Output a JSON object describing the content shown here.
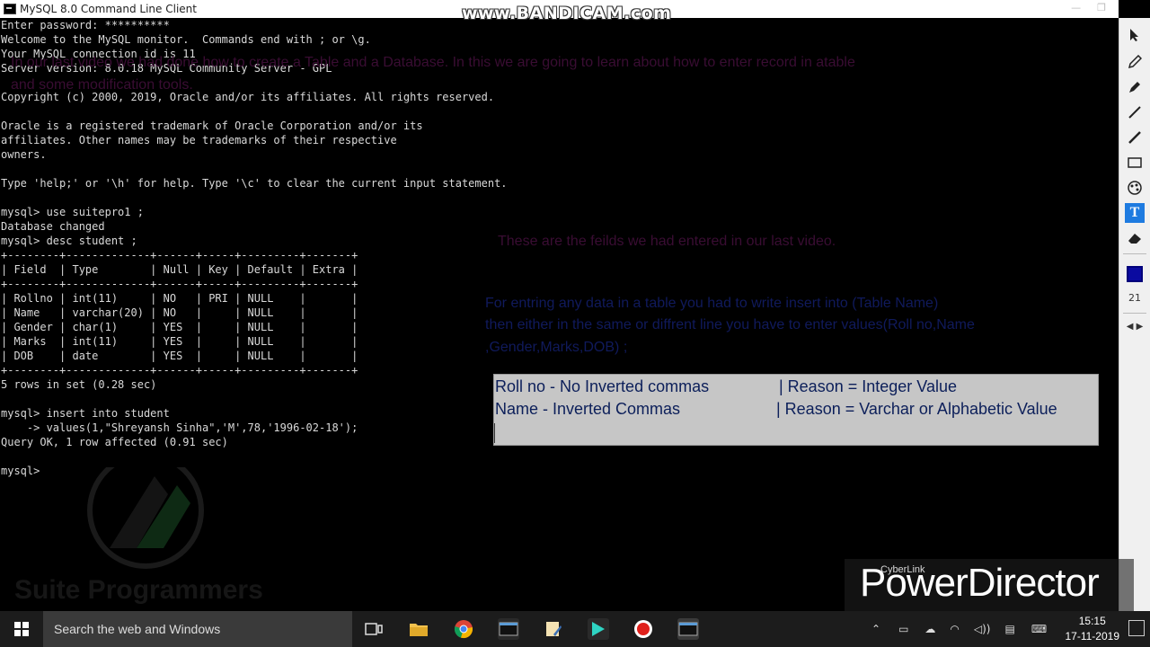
{
  "window": {
    "title": "MySQL 8.0 Command Line Client",
    "recorder_watermark": "www.BANDICAM.com"
  },
  "console": {
    "lines": [
      "Enter password: **********",
      "Welcome to the MySQL monitor.  Commands end with ; or \\g.",
      "Your MySQL connection id is 11",
      "Server version: 8.0.18 MySQL Community Server - GPL",
      "",
      "Copyright (c) 2000, 2019, Oracle and/or its affiliates. All rights reserved.",
      "",
      "Oracle is a registered trademark of Oracle Corporation and/or its",
      "affiliates. Other names may be trademarks of their respective",
      "owners.",
      "",
      "Type 'help;' or '\\h' for help. Type '\\c' to clear the current input statement.",
      "",
      "mysql> use suitepro1 ;",
      "Database changed",
      "mysql> desc student ;",
      "+--------+-------------+------+-----+---------+-------+",
      "| Field  | Type        | Null | Key | Default | Extra |",
      "+--------+-------------+------+-----+---------+-------+",
      "| Rollno | int(11)     | NO   | PRI | NULL    |       |",
      "| Name   | varchar(20) | NO   |     | NULL    |       |",
      "| Gender | char(1)     | YES  |     | NULL    |       |",
      "| Marks  | int(11)     | YES  |     | NULL    |       |",
      "| DOB    | date        | YES  |     | NULL    |       |",
      "+--------+-------------+------+-----+---------+-------+",
      "5 rows in set (0.28 sec)",
      "",
      "mysql> insert into student",
      "    -> values(1,\"Shreyansh Sinha\",'M',78,'1996-02-18');",
      "Query OK, 1 row affected (0.91 sec)",
      "",
      "mysql> "
    ]
  },
  "annotations": {
    "intro_line1": "In our last video we had done how to create a Table and a Database. In this we are going to learn about how to enter record in atable",
    "intro_line2": "and some modification tools.",
    "fields_note": "These are the feilds we had entered in our last video.",
    "insert_note_line1": "For entring any data in a table you had to write insert into (Table Name)",
    "insert_note_line2": "then either in the same or diffrent line you have to enter values(Roll no,Name",
    "insert_note_line3": ",Gender,Marks,DOB) ;"
  },
  "reason_box": {
    "row1_left": "Roll no - No Inverted commas",
    "row1_right": "| Reason = Integer Value",
    "row2_left": "Name - Inverted Commas",
    "row2_right": "| Reason = Varchar or Alphabetic Value"
  },
  "toolbar": {
    "tools": [
      "cursor-tool",
      "pen-tool",
      "marker-tool",
      "line-tool",
      "brush-tool",
      "rectangle-tool",
      "palette-tool",
      "text-tool",
      "eraser-tool"
    ],
    "active_tool": "text-tool",
    "active_color": "#0a0aa0",
    "size": "21"
  },
  "watermarks": {
    "logo_text": "Suite Programmers",
    "cyberlink": "CyberLink",
    "powerdirector": "PowerDirector"
  },
  "taskbar": {
    "search_placeholder": "Search the web and Windows",
    "time": "15:15",
    "date": "17-11-2019"
  }
}
